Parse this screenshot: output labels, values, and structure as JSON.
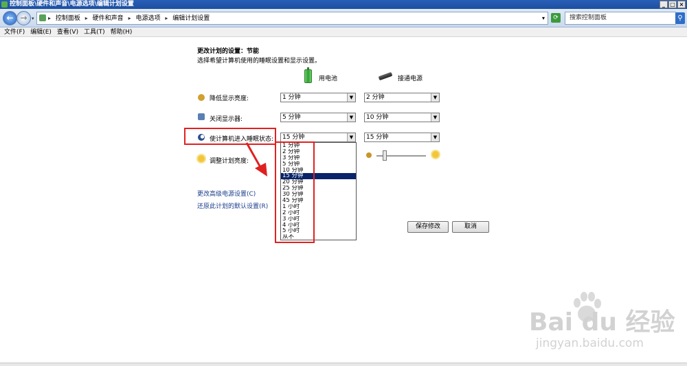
{
  "window": {
    "title": "控制面板\\硬件和声音\\电源选项\\编辑计划设置"
  },
  "address": {
    "crumbs": [
      "控制面板",
      "硬件和声音",
      "电源选项",
      "编辑计划设置"
    ],
    "search_placeholder": "搜索控制面板"
  },
  "menu": [
    "文件(F)",
    "编辑(E)",
    "查看(V)",
    "工具(T)",
    "帮助(H)"
  ],
  "main": {
    "title": "更改计划的设置：节能",
    "subtitle": "选择希望计算机使用的睡眠设置和显示设置。",
    "col_battery": "用电池",
    "col_plugged": "接通电源",
    "rows": [
      {
        "label": "降低显示亮度:",
        "battery": "1 分钟",
        "plugged": "2 分钟"
      },
      {
        "label": "关闭显示器:",
        "battery": "5 分钟",
        "plugged": "10 分钟"
      },
      {
        "label": "使计算机进入睡眠状态:",
        "battery": "15 分钟",
        "plugged": "15 分钟"
      },
      {
        "label": "调整计划亮度:"
      }
    ],
    "links": [
      "更改高级电源设置(C)",
      "还原此计划的默认设置(R)"
    ],
    "save_label": "保存修改",
    "cancel_label": "取消"
  },
  "dropdown": {
    "options": [
      "1 分钟",
      "2 分钟",
      "3 分钟",
      "5 分钟",
      "10 分钟",
      "15 分钟",
      "20 分钟",
      "25 分钟",
      "30 分钟",
      "45 分钟",
      "1 小时",
      "2 小时",
      "3 小时",
      "4 小时",
      "5 小时",
      "从不"
    ],
    "selected": "15 分钟"
  },
  "watermark": {
    "brand": "Bai du 经验",
    "url": "jingyan.baidu.com"
  },
  "colors": {
    "highlight": "#0a246a",
    "annotation": "#e02020",
    "link": "#1a3e8c"
  }
}
